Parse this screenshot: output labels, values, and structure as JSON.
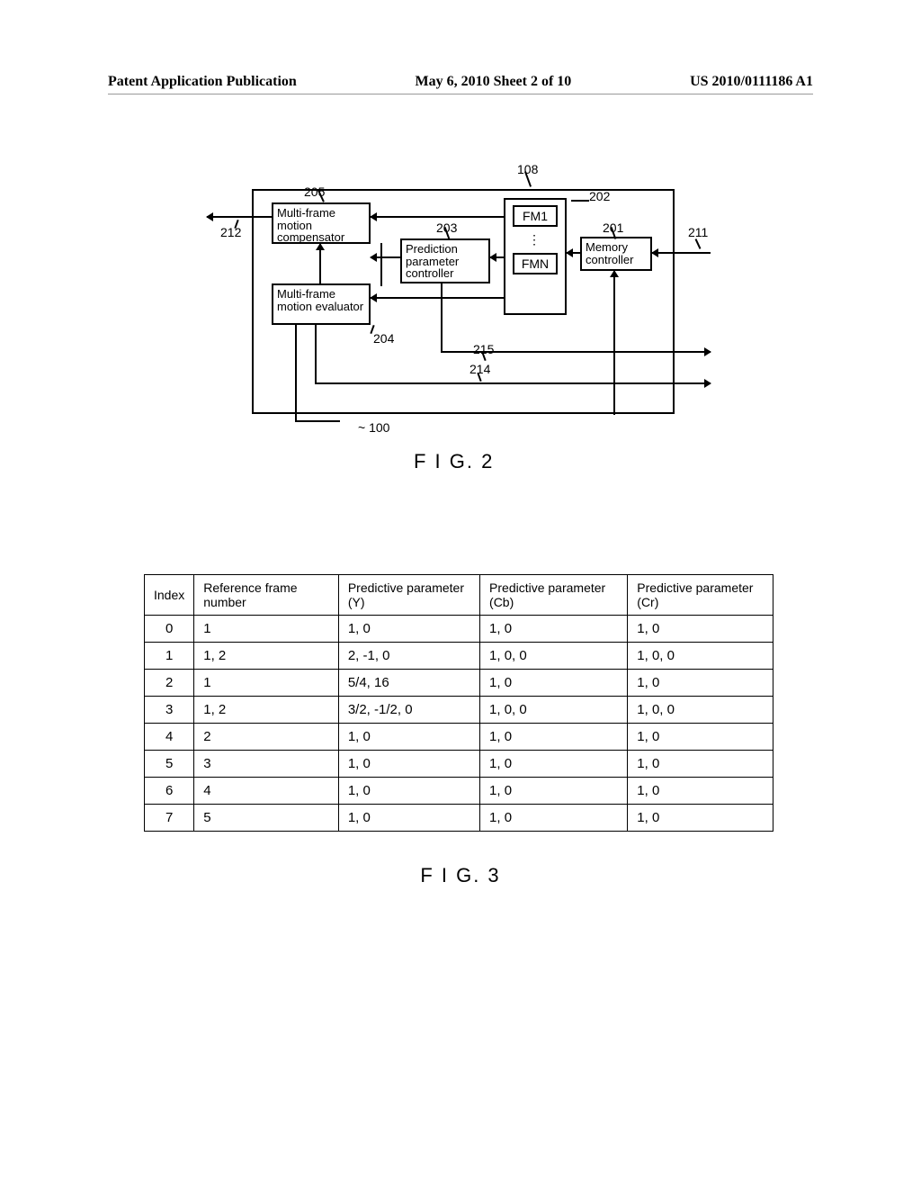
{
  "header": {
    "left": "Patent Application Publication",
    "center": "May 6, 2010  Sheet 2 of 10",
    "right": "US 2010/0111186 A1"
  },
  "fig2": {
    "ref_compensator": "Multi-frame motion compensator",
    "ref_evaluator": "Multi-frame motion evaluator",
    "pred_param": "Prediction parameter controller",
    "mem_ctrl": "Memory controller",
    "fm1": "FM1",
    "fmn": "FMN",
    "dots": "⋮",
    "lbl_108": "108",
    "lbl_205": "205",
    "lbl_202": "202",
    "lbl_203": "203",
    "lbl_201": "201",
    "lbl_211": "211",
    "lbl_212": "212",
    "lbl_204": "204",
    "lbl_214": "214",
    "lbl_215": "215",
    "lbl_100": "100",
    "caption": "F I G. 2"
  },
  "fig3": {
    "headers": [
      "Index",
      "Reference frame number",
      "Predictive parameter (Y)",
      "Predictive parameter (Cb)",
      "Predictive parameter (Cr)"
    ],
    "rows": [
      [
        "0",
        "1",
        "1, 0",
        "1, 0",
        "1, 0"
      ],
      [
        "1",
        "1, 2",
        "2, -1, 0",
        "1, 0, 0",
        "1, 0, 0"
      ],
      [
        "2",
        "1",
        "5/4, 16",
        "1, 0",
        "1, 0"
      ],
      [
        "3",
        "1, 2",
        "3/2, -1/2, 0",
        "1, 0, 0",
        "1, 0, 0"
      ],
      [
        "4",
        "2",
        "1, 0",
        "1, 0",
        "1, 0"
      ],
      [
        "5",
        "3",
        "1, 0",
        "1, 0",
        "1, 0"
      ],
      [
        "6",
        "4",
        "1, 0",
        "1, 0",
        "1, 0"
      ],
      [
        "7",
        "5",
        "1, 0",
        "1, 0",
        "1, 0"
      ]
    ],
    "caption": "F I G. 3"
  },
  "chart_data": {
    "type": "table",
    "title": "FIG. 3 — prediction parameters by index",
    "columns": [
      "Index",
      "Reference frame number",
      "Predictive parameter (Y)",
      "Predictive parameter (Cb)",
      "Predictive parameter (Cr)"
    ],
    "rows": [
      [
        0,
        "1",
        "1,0",
        "1,0",
        "1,0"
      ],
      [
        1,
        "1,2",
        "2,-1,0",
        "1,0,0",
        "1,0,0"
      ],
      [
        2,
        "1",
        "5/4,16",
        "1,0",
        "1,0"
      ],
      [
        3,
        "1,2",
        "3/2,-1/2,0",
        "1,0,0",
        "1,0,0"
      ],
      [
        4,
        "2",
        "1,0",
        "1,0",
        "1,0"
      ],
      [
        5,
        "3",
        "1,0",
        "1,0",
        "1,0"
      ],
      [
        6,
        "4",
        "1,0",
        "1,0",
        "1,0"
      ],
      [
        7,
        "5",
        "1,0",
        "1,0",
        "1,0"
      ]
    ]
  }
}
